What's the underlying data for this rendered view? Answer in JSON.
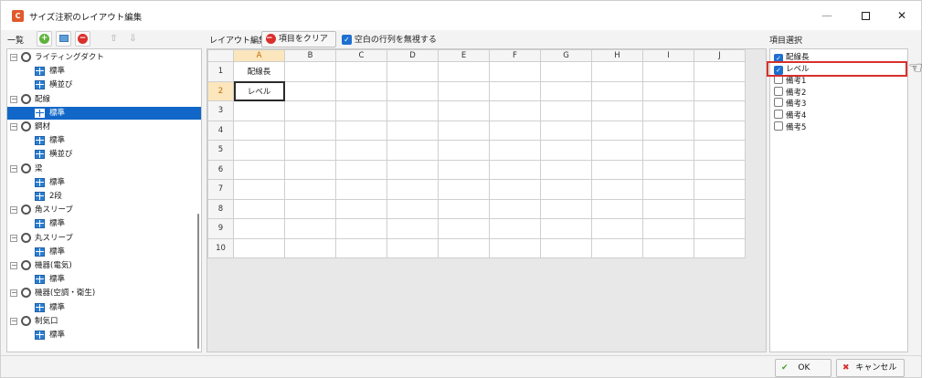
{
  "window": {
    "title": "サイズ注釈のレイアウト編集",
    "app_icon": "C",
    "minimize_glyph": "—",
    "close_glyph": "✕"
  },
  "toolbar": {
    "list_label": "一覧",
    "layout_label": "レイアウト編集",
    "clear_label": "項目をクリアー",
    "ignore_blank_label": "空白の行列を無視する",
    "ignore_blank_checked": true,
    "item_select_label": "項目選択",
    "up_glyph": "⇧",
    "down_glyph": "⇩"
  },
  "tree": [
    {
      "type": "group",
      "label": "ライティングダクト"
    },
    {
      "type": "leaf",
      "label": "標準"
    },
    {
      "type": "leaf",
      "label": "横並び"
    },
    {
      "type": "group",
      "label": "配線"
    },
    {
      "type": "leaf",
      "label": "標準",
      "selected": true
    },
    {
      "type": "group",
      "label": "鋼材"
    },
    {
      "type": "leaf",
      "label": "標準"
    },
    {
      "type": "leaf",
      "label": "横並び"
    },
    {
      "type": "group",
      "label": "梁"
    },
    {
      "type": "leaf",
      "label": "標準"
    },
    {
      "type": "leaf",
      "label": "2段"
    },
    {
      "type": "group",
      "label": "角スリーブ"
    },
    {
      "type": "leaf",
      "label": "標準"
    },
    {
      "type": "group",
      "label": "丸スリーブ"
    },
    {
      "type": "leaf",
      "label": "標準"
    },
    {
      "type": "group",
      "label": "機器(電気)"
    },
    {
      "type": "leaf",
      "label": "標準"
    },
    {
      "type": "group",
      "label": "機器(空調・衛生)"
    },
    {
      "type": "leaf",
      "label": "標準"
    },
    {
      "type": "group",
      "label": "制気口"
    },
    {
      "type": "leaf",
      "label": "標準"
    }
  ],
  "sheet": {
    "columns": [
      "A",
      "B",
      "C",
      "D",
      "E",
      "F",
      "G",
      "H",
      "I",
      "J"
    ],
    "rows": [
      "1",
      "2",
      "3",
      "4",
      "5",
      "6",
      "7",
      "8",
      "9",
      "10"
    ],
    "cells": {
      "0-0": "配線長",
      "1-0": "レベル"
    },
    "active_row": 1,
    "active_col": 0
  },
  "items": [
    {
      "label": "配線長",
      "checked": true
    },
    {
      "label": "レベル",
      "checked": true
    },
    {
      "label": "備考1",
      "checked": false
    },
    {
      "label": "備考2",
      "checked": false
    },
    {
      "label": "備考3",
      "checked": false
    },
    {
      "label": "備考4",
      "checked": false
    },
    {
      "label": "備考5",
      "checked": false
    }
  ],
  "buttons": {
    "ok_label": "OK",
    "cancel_label": "キャンセル"
  }
}
